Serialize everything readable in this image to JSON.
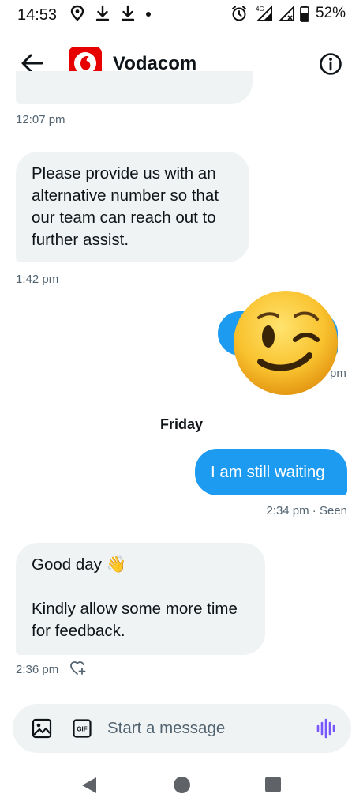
{
  "status_bar": {
    "time": "14:53",
    "left_icons": [
      "location-pin-icon",
      "download-icon",
      "download-icon",
      "dot-icon"
    ],
    "right_icons": [
      "alarm-icon",
      "network-4g-icon",
      "signal-icon"
    ],
    "network_label": "4G",
    "battery": "52%"
  },
  "header": {
    "back_icon": "arrow-left-icon",
    "contact_name": "Vodacom",
    "brand_color": "#e60000",
    "info_icon": "info-icon"
  },
  "messages": [
    {
      "id": "m0",
      "direction": "in",
      "partial": true,
      "timestamp": "12:07 pm"
    },
    {
      "id": "m1",
      "direction": "in",
      "lines": [
        "Please provide us with an",
        "alternative number so that",
        "our team can reach out to",
        "further assist."
      ],
      "timestamp": "1:42 pm"
    },
    {
      "id": "m2",
      "direction": "out",
      "emoji": "winking-face",
      "timestamp_fragment": "pm"
    },
    {
      "id": "day",
      "label": "Friday"
    },
    {
      "id": "m3",
      "direction": "out",
      "text": "I am still waiting",
      "timestamp": "2:34 pm",
      "status": "Seen",
      "meta": "2:34 pm · Seen"
    },
    {
      "id": "m4",
      "direction": "in",
      "lines": [
        "Good day 👋",
        "",
        "Kindly allow some more time",
        "for feedback."
      ],
      "timestamp": "2:36 pm",
      "reaction_icon": "add-reaction-heart-icon"
    }
  ],
  "composer": {
    "placeholder": "Start a message",
    "media_icon": "image-icon",
    "gif_icon": "gif-icon",
    "gif_label": "GIF",
    "voice_icon": "voice-message-icon",
    "voice_color": "#7856ff"
  },
  "nav_bar": {
    "back": "nav-back-icon",
    "home": "nav-home-icon",
    "recents": "nav-recents-icon"
  },
  "colors": {
    "outgoing_bubble": "#1d9bf0",
    "incoming_bubble": "#eff3f4",
    "meta_text": "#536471"
  }
}
